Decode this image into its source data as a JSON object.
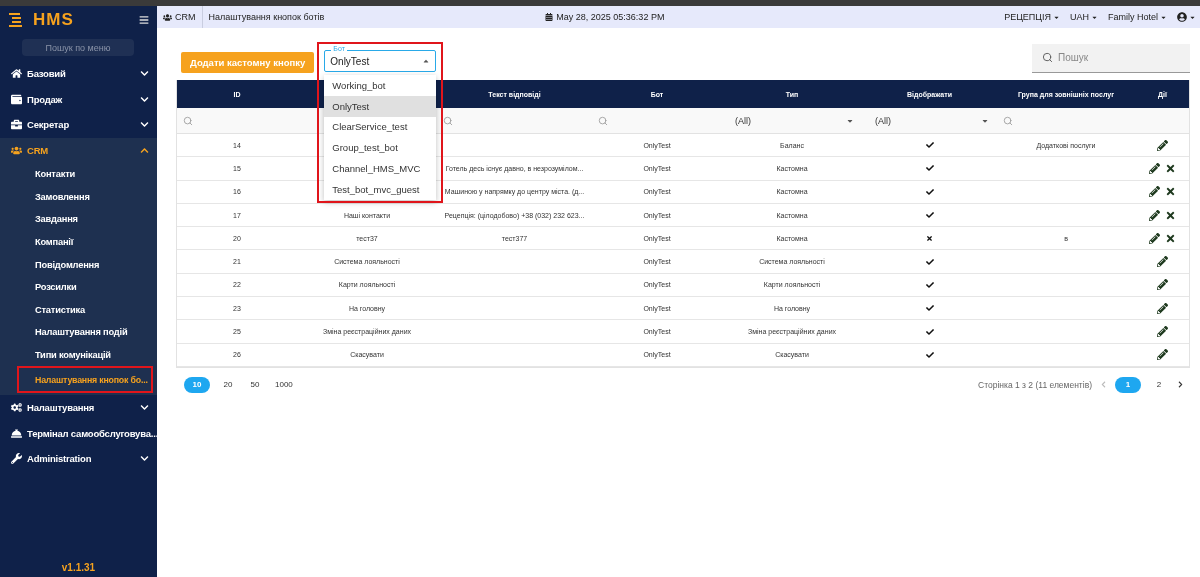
{
  "logo": {
    "text": "HMS"
  },
  "sidebar": {
    "search_placeholder": "Пошук по меню",
    "items": [
      {
        "label": "Базовий",
        "expanded": false,
        "has_children": true,
        "selected": false
      },
      {
        "label": "Продаж",
        "expanded": false,
        "has_children": true,
        "selected": false
      },
      {
        "label": "Секретар",
        "expanded": false,
        "has_children": true,
        "selected": false
      },
      {
        "label": "CRM",
        "expanded": true,
        "has_children": true,
        "selected": true,
        "children": [
          {
            "label": "Контакти",
            "selected": false,
            "highlighted": false
          },
          {
            "label": "Замовлення",
            "selected": false,
            "highlighted": false
          },
          {
            "label": "Завдання",
            "selected": false,
            "highlighted": false
          },
          {
            "label": "Компанії",
            "selected": false,
            "highlighted": false
          },
          {
            "label": "Повідомлення",
            "selected": false,
            "highlighted": false
          },
          {
            "label": "Розсилки",
            "selected": false,
            "highlighted": false
          },
          {
            "label": "Статистика",
            "selected": false,
            "highlighted": false
          },
          {
            "label": "Налаштування подій",
            "selected": false,
            "highlighted": false
          },
          {
            "label": "Типи комунікацій",
            "selected": false,
            "highlighted": false
          },
          {
            "label": "Налаштування кнопок бо...",
            "selected": true,
            "highlighted": true
          }
        ]
      },
      {
        "label": "Налаштування",
        "expanded": false,
        "has_children": true,
        "selected": false
      },
      {
        "label": "Термінал самообслуговува...",
        "expanded": false,
        "has_children": false,
        "selected": false
      },
      {
        "label": "Administration",
        "expanded": false,
        "has_children": true,
        "selected": false
      }
    ],
    "version": "v1.1.31"
  },
  "header": {
    "breadcrumb": [
      "CRM",
      "Налаштування кнопок ботів"
    ],
    "datetime": "May 28, 2025 05:36:32 PM",
    "menus": [
      "РЕЦЕПЦІЯ",
      "UAH",
      "Family Hotel"
    ]
  },
  "toolbar": {
    "add_button": "Додати кастомну кнопку",
    "bot_select": {
      "label": "Бот",
      "value": "OnlyTest",
      "expanded": true,
      "highlighted": true,
      "options": [
        {
          "label": "Working_bot",
          "selected": false
        },
        {
          "label": "OnlyTest",
          "selected": true
        },
        {
          "label": "ClearService_test",
          "selected": false
        },
        {
          "label": "Group_test_bot",
          "selected": false
        },
        {
          "label": "Channel_HMS_MVC",
          "selected": false
        },
        {
          "label": "Test_bot_mvc_guest",
          "selected": false
        }
      ]
    },
    "search": {
      "placeholder": "Пошук"
    }
  },
  "table": {
    "columns": {
      "id": "ID",
      "text": "Текст відповіді",
      "bot": "Бот",
      "type": "Тип",
      "visible": "Відображати",
      "group": "Група для зовнішніх послуг",
      "actions": "Дії"
    },
    "filters": {
      "id": {
        "kind": "search"
      },
      "text": {
        "kind": "search"
      },
      "bot": {
        "kind": "search"
      },
      "type": {
        "kind": "select",
        "value": "(All)"
      },
      "visible": {
        "kind": "select",
        "value": "(All)"
      },
      "group": {
        "kind": "search"
      }
    },
    "rows": [
      {
        "id": "14",
        "bot": "OnlyTest",
        "type": "Баланс",
        "visible": true,
        "group": "Додаткові послуги",
        "deletable": false
      },
      {
        "id": "15",
        "text": "Готель десь існує давно, в незрозумілом...",
        "bot": "OnlyTest",
        "type": "Кастомна",
        "visible": true,
        "deletable": true
      },
      {
        "id": "16",
        "text": "Машиною у напрямку до центру міста. (д...",
        "bot": "OnlyTest",
        "type": "Кастомна",
        "visible": true,
        "deletable": true
      },
      {
        "id": "17",
        "name": "Наші контакти",
        "text": "Рецепція: (цілодобово) +38 (032) 232 623...",
        "bot": "OnlyTest",
        "type": "Кастомна",
        "visible": true,
        "deletable": true
      },
      {
        "id": "20",
        "name": "тест37",
        "text": "тест377",
        "bot": "OnlyTest",
        "type": "Кастомна",
        "visible": false,
        "group": "в",
        "deletable": true
      },
      {
        "id": "21",
        "name": "Система лояльності",
        "bot": "OnlyTest",
        "type": "Система лояльності",
        "visible": true,
        "deletable": false
      },
      {
        "id": "22",
        "name": "Карти лояльності",
        "bot": "OnlyTest",
        "type": "Карти лояльності",
        "visible": true,
        "deletable": false
      },
      {
        "id": "23",
        "name": "На головну",
        "bot": "OnlyTest",
        "type": "На головну",
        "visible": true,
        "deletable": false
      },
      {
        "id": "25",
        "name": "Зміна реєстраційних даних",
        "bot": "OnlyTest",
        "type": "Зміна реєстраційних даних",
        "visible": true,
        "deletable": false
      },
      {
        "id": "26",
        "name": "Скасувати",
        "bot": "OnlyTest",
        "type": "Скасувати",
        "visible": true,
        "deletable": false
      }
    ]
  },
  "pagination": {
    "page_sizes": [
      {
        "label": "10",
        "selected": true
      },
      {
        "label": "20",
        "selected": false
      },
      {
        "label": "50",
        "selected": false
      },
      {
        "label": "1000",
        "selected": false
      }
    ],
    "summary": "Сторінка 1 з 2 (11 елементів)",
    "pages": [
      {
        "label": "1",
        "selected": true
      },
      {
        "label": "2",
        "selected": false
      }
    ]
  }
}
